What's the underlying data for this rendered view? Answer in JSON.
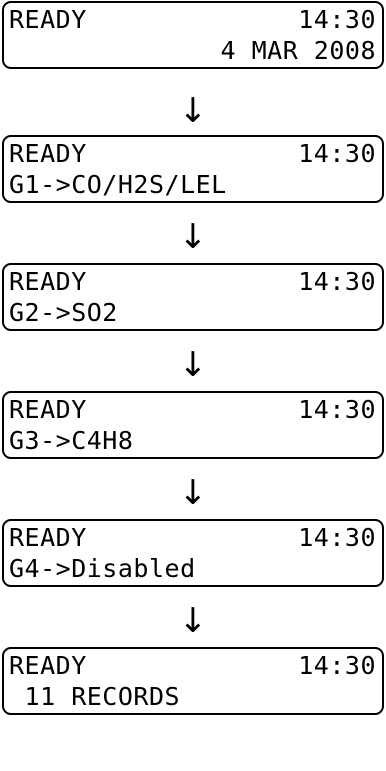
{
  "screens": [
    {
      "status": "READY",
      "time": "14:30",
      "line2": "4 MAR 2008",
      "line2_align": "right"
    },
    {
      "status": "READY",
      "time": "14:30",
      "line2": "G1->CO/H2S/LEL",
      "line2_align": "left"
    },
    {
      "status": "READY",
      "time": "14:30",
      "line2": "G2->SO2",
      "line2_align": "left"
    },
    {
      "status": "READY",
      "time": "14:30",
      "line2": "G3->C4H8",
      "line2_align": "left"
    },
    {
      "status": "READY",
      "time": "14:30",
      "line2": "G4->Disabled",
      "line2_align": "left"
    },
    {
      "status": "READY",
      "time": "14:30",
      "line2": " 11 RECORDS",
      "line2_align": "left"
    }
  ],
  "arrow_icon": "down-arrow-icon",
  "arrow_glyph": "↓"
}
